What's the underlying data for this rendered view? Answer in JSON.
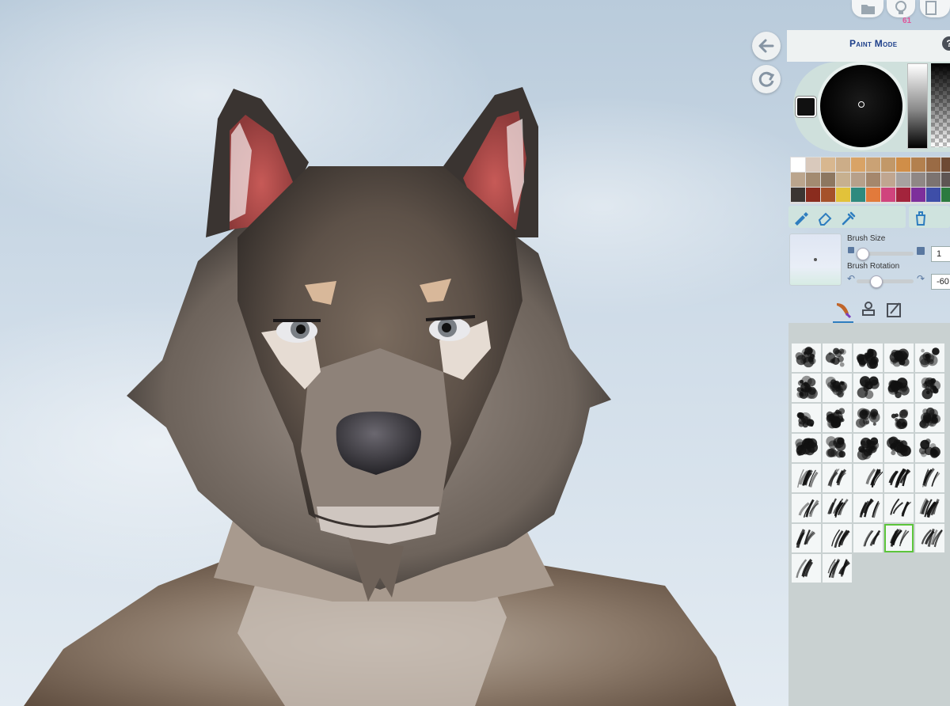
{
  "header": {
    "paint_mode_title": "Paint Mode",
    "help_glyph": "?",
    "notification_count": "61"
  },
  "icons": {
    "top": [
      "folder-icon",
      "lightbulb-icon",
      "document-icon"
    ],
    "side": [
      "back-arrow-icon",
      "refresh-icon"
    ],
    "tools": [
      "brush-icon",
      "eraser-icon",
      "eyedropper-icon",
      "bucket-icon"
    ],
    "tabs": [
      "brush-tab-icon",
      "stamp-tab-icon",
      "sticker-tab-icon"
    ]
  },
  "color_picker": {
    "current_color": "#111111",
    "palette": [
      "#ffffff",
      "#d9c9bc",
      "#d8b78f",
      "#ccad88",
      "#d9a366",
      "#caa275",
      "#c29868",
      "#d08e48",
      "#b3804e",
      "#9a6b45",
      "#6e4a33",
      "#bba58d",
      "#a38b71",
      "#8d7760",
      "#c7b08f",
      "#b7a08a",
      "#a5876c",
      "#c0a690",
      "#a7a2a0",
      "#8f8785",
      "#7c7370",
      "#5e5553",
      "#3b3532",
      "#8a2c1e",
      "#a5512a",
      "#e2c23a",
      "#2e8a7e",
      "#e27a3b",
      "#d0447d",
      "#a3243c",
      "#7d2f9b",
      "#3e4ea8",
      "#2b7a3f"
    ]
  },
  "brush": {
    "size_label": "Brush Size",
    "size_value": "1",
    "size_level": 0.1,
    "rotation_label": "Brush Rotation",
    "rotation_value": "-60",
    "rotation_level": 0.33
  },
  "brush_library": {
    "selected_index": 33,
    "count": 37
  }
}
